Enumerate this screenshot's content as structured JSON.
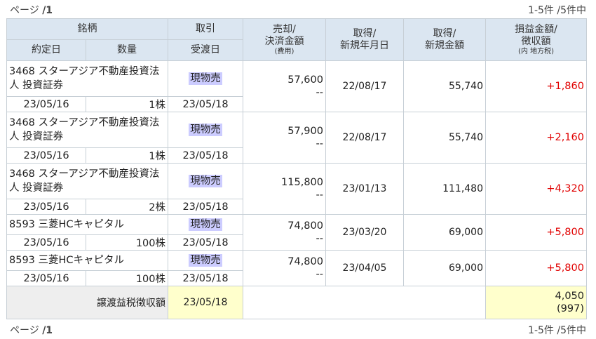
{
  "pager": {
    "page_label": "ページ",
    "page_num": "/1",
    "count": "1-5件 /5件中"
  },
  "headers": {
    "meigara": "銘柄",
    "torihiki": "取引",
    "sell_l1": "売却/",
    "sell_l2": "決済金額",
    "sell_l3": "(費用)",
    "acq_date_l1": "取得/",
    "acq_date_l2": "新規年月日",
    "acq_amt_l1": "取得/",
    "acq_amt_l2": "新規金額",
    "pl_l1": "損益金額/",
    "pl_l2": "徴収額",
    "pl_l3": "(内 地方税)",
    "trade_date": "約定日",
    "quantity": "数量",
    "settle_date": "受渡日"
  },
  "rows": [
    {
      "name": "3468 スターアジア不動産投資法人 投資証券",
      "type": "現物売",
      "sell": "57,600",
      "cost": "--",
      "acq_date": "22/08/17",
      "acq_amt": "55,740",
      "pl": "+1,860",
      "trade_date": "23/05/16",
      "qty": "1株",
      "settle": "23/05/18"
    },
    {
      "name": "3468 スターアジア不動産投資法人 投資証券",
      "type": "現物売",
      "sell": "57,900",
      "cost": "--",
      "acq_date": "22/08/17",
      "acq_amt": "55,740",
      "pl": "+2,160",
      "trade_date": "23/05/16",
      "qty": "1株",
      "settle": "23/05/18"
    },
    {
      "name": "3468 スターアジア不動産投資法人 投資証券",
      "type": "現物売",
      "sell": "115,800",
      "cost": "--",
      "acq_date": "23/01/13",
      "acq_amt": "111,480",
      "pl": "+4,320",
      "trade_date": "23/05/16",
      "qty": "2株",
      "settle": "23/05/18"
    },
    {
      "name": "8593 三菱HCキャピタル",
      "type": "現物売",
      "sell": "74,800",
      "cost": "--",
      "acq_date": "23/03/20",
      "acq_amt": "69,000",
      "pl": "+5,800",
      "trade_date": "23/05/16",
      "qty": "100株",
      "settle": "23/05/18"
    },
    {
      "name": "8593 三菱HCキャピタル",
      "type": "現物売",
      "sell": "74,800",
      "cost": "--",
      "acq_date": "23/04/05",
      "acq_amt": "69,000",
      "pl": "+5,800",
      "trade_date": "23/05/16",
      "qty": "100株",
      "settle": "23/05/18"
    }
  ],
  "summary": {
    "label": "譲渡益税徴収額",
    "date": "23/05/18",
    "amount": "4,050",
    "local_tax": "(997)"
  }
}
